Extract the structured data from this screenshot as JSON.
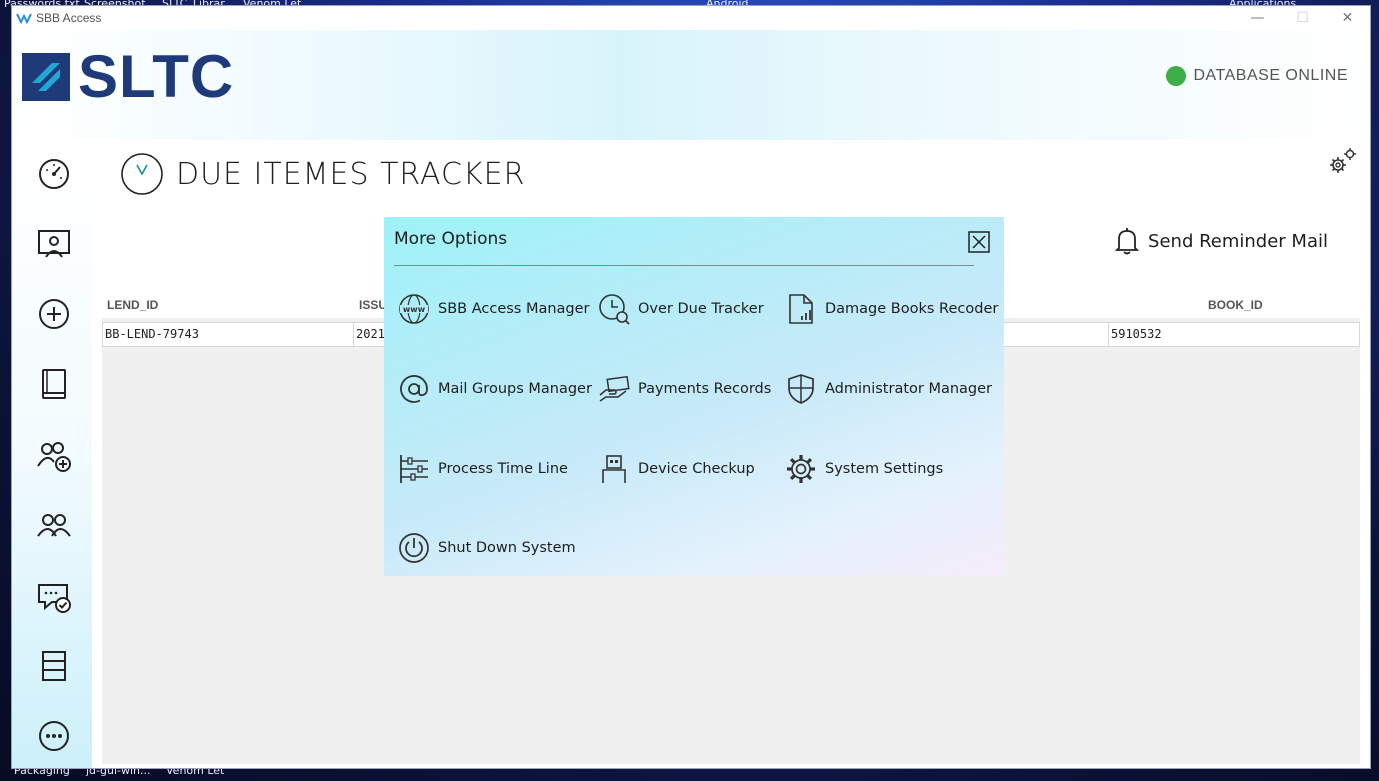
{
  "desktop": {
    "top_items": [
      "Passwords.txt",
      "Screenshot",
      "SLTC_Librar",
      "Venom Let",
      "Android",
      "Applications"
    ],
    "bottom_items": [
      "Packaging",
      "jd-gui-win...",
      "Venom Let"
    ]
  },
  "window": {
    "title": "SBB Access",
    "controls": {
      "minimize": "—",
      "maximize": "☐",
      "close": "✕"
    }
  },
  "brand": {
    "logo_text": "SLTC",
    "color": "#1e3a78"
  },
  "status": {
    "text": "DATABASE ONLINE",
    "color": "#3dae4a"
  },
  "sidebar": {
    "items": [
      {
        "name": "dashboard",
        "icon": "speedometer-icon"
      },
      {
        "name": "presentation",
        "icon": "presentation-icon"
      },
      {
        "name": "add",
        "icon": "plus-circle-icon"
      },
      {
        "name": "books",
        "icon": "book-icon"
      },
      {
        "name": "add-member",
        "icon": "people-add-icon"
      },
      {
        "name": "members",
        "icon": "people-icon"
      },
      {
        "name": "messages",
        "icon": "chat-check-icon"
      },
      {
        "name": "records",
        "icon": "list-icon"
      },
      {
        "name": "more",
        "icon": "more-icon"
      }
    ]
  },
  "page": {
    "title": "DUE ITEMES TRACKER",
    "reminder_label": "Send Reminder Mail"
  },
  "table": {
    "columns": [
      "LEND_ID",
      "ISSU",
      "BOOK_ID"
    ],
    "rows": [
      {
        "lend_id": "BB-LEND-79743",
        "issue": "2021",
        "book_id": "5910532"
      }
    ]
  },
  "popup": {
    "title": "More Options",
    "options": [
      {
        "label": "SBB Access Manager",
        "icon": "www-globe-icon"
      },
      {
        "label": "Over Due Tracker",
        "icon": "clock-search-icon"
      },
      {
        "label": "Damage Books Recoder",
        "icon": "document-chart-icon"
      },
      {
        "label": "Mail Groups Manager",
        "icon": "at-sign-icon"
      },
      {
        "label": "Payments Records",
        "icon": "hand-payment-icon"
      },
      {
        "label": "Administrator Manager",
        "icon": "shield-icon"
      },
      {
        "label": "Process Time Line",
        "icon": "timeline-icon"
      },
      {
        "label": "Device Checkup",
        "icon": "usb-device-icon"
      },
      {
        "label": "System Settings",
        "icon": "gear-icon"
      },
      {
        "label": "Shut Down System",
        "icon": "power-icon"
      }
    ]
  }
}
